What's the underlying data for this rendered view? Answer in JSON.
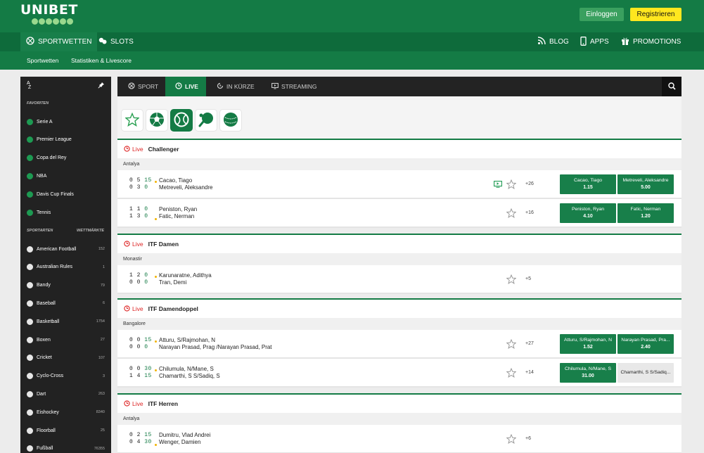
{
  "brand": {
    "name": "UNIBET"
  },
  "header": {
    "login": "Einloggen",
    "register": "Registrieren"
  },
  "mainnav": {
    "sportwetten": "SPORTWETTEN",
    "slots": "SLOTS",
    "blog": "BLOG",
    "apps": "APPS",
    "promotions": "PROMOTIONS"
  },
  "subnav": {
    "item1": "Sportwetten",
    "item2": "Statistiken & Livescore"
  },
  "sidebar": {
    "sort_label": "A Z",
    "favorites_title": "FAVORITEN",
    "favorites": [
      {
        "label": "Serie A"
      },
      {
        "label": "Premier League"
      },
      {
        "label": "Copa del Rey"
      },
      {
        "label": "NBA"
      },
      {
        "label": "Davis Cup Finals"
      },
      {
        "label": "Tennis"
      }
    ],
    "sports_title": "SPORTARTEN",
    "markets_title": "WETTMÄRKTE",
    "sports": [
      {
        "label": "American Football",
        "count": "152"
      },
      {
        "label": "Australian Rules",
        "count": "1"
      },
      {
        "label": "Bandy",
        "count": "79"
      },
      {
        "label": "Baseball",
        "count": "6"
      },
      {
        "label": "Basketball",
        "count": "1754"
      },
      {
        "label": "Boxen",
        "count": "27"
      },
      {
        "label": "Cricket",
        "count": "107"
      },
      {
        "label": "Cyclo-Cross",
        "count": "3"
      },
      {
        "label": "Dart",
        "count": "263"
      },
      {
        "label": "Eishockey",
        "count": "8340"
      },
      {
        "label": "Floorball",
        "count": "25"
      },
      {
        "label": "Fußball",
        "count": "76355"
      }
    ]
  },
  "tabs": {
    "sport": "SPORT",
    "live": "LIVE",
    "soon": "IN KÜRZE",
    "streaming": "STREAMING"
  },
  "live_label": "Live",
  "groups": [
    {
      "name": "Challenger",
      "location": "Antalya",
      "matches": [
        {
          "p1": "Cacao, Tiago",
          "p2": "Metreveli, Aleksandre",
          "s1": [
            "0",
            "5",
            "15"
          ],
          "s2": [
            "0",
            "3",
            "0"
          ],
          "more": "+26",
          "o1": {
            "name": "Cacao, Tiago",
            "odd": "1.15"
          },
          "o2": {
            "name": "Metreveli, Aleksandre",
            "odd": "5.00"
          }
        },
        {
          "p1": "Peniston, Ryan",
          "p2": "Fatic, Nerman",
          "s1": [
            "1",
            "1",
            "0"
          ],
          "s2": [
            "1",
            "3",
            "0"
          ],
          "more": "+16",
          "o1": {
            "name": "Peniston, Ryan",
            "odd": "4.10"
          },
          "o2": {
            "name": "Fatic, Nerman",
            "odd": "1.20"
          }
        }
      ]
    },
    {
      "name": "ITF Damen",
      "location": "Monastir",
      "matches": [
        {
          "p1": "Karunaratne, Adithya",
          "p2": "Tran, Demi",
          "s1": [
            "1",
            "2",
            "0"
          ],
          "s2": [
            "0",
            "0",
            "0"
          ],
          "more": "+5"
        }
      ]
    },
    {
      "name": "ITF Damendoppel",
      "location": "Bangalore",
      "matches": [
        {
          "p1": "Atturu, S/Rajmohan, N",
          "p2": "Narayan Prasad, Prag /Narayan Prasad, Prat",
          "s1": [
            "0",
            "0",
            "15"
          ],
          "s2": [
            "0",
            "0",
            "0"
          ],
          "more": "+27",
          "o1": {
            "name": "Atturu, S/Rajmohan, N",
            "odd": "1.52"
          },
          "o2": {
            "name": "Narayan Prasad, Pra...",
            "odd": "2.40"
          }
        },
        {
          "p1": "Chilumula, N/Mane, S",
          "p2": "Chamarthi, S S/Sadiq, S",
          "s1": [
            "0",
            "0",
            "30"
          ],
          "s2": [
            "1",
            "4",
            "15"
          ],
          "more": "+14",
          "o1": {
            "name": "Chilumula, N/Mane, S",
            "odd": "31.00"
          },
          "o2": {
            "name": "Chamarthi, S S/Sadiq..."
          }
        }
      ]
    },
    {
      "name": "ITF Herren",
      "location": "Antalya",
      "matches": [
        {
          "p1": "Dumitru, Vlad Andrei",
          "p2": "Wenger, Damien",
          "s1": [
            "0",
            "2",
            "15"
          ],
          "s2": [
            "0",
            "4",
            "30"
          ],
          "more": "+6"
        }
      ]
    }
  ]
}
